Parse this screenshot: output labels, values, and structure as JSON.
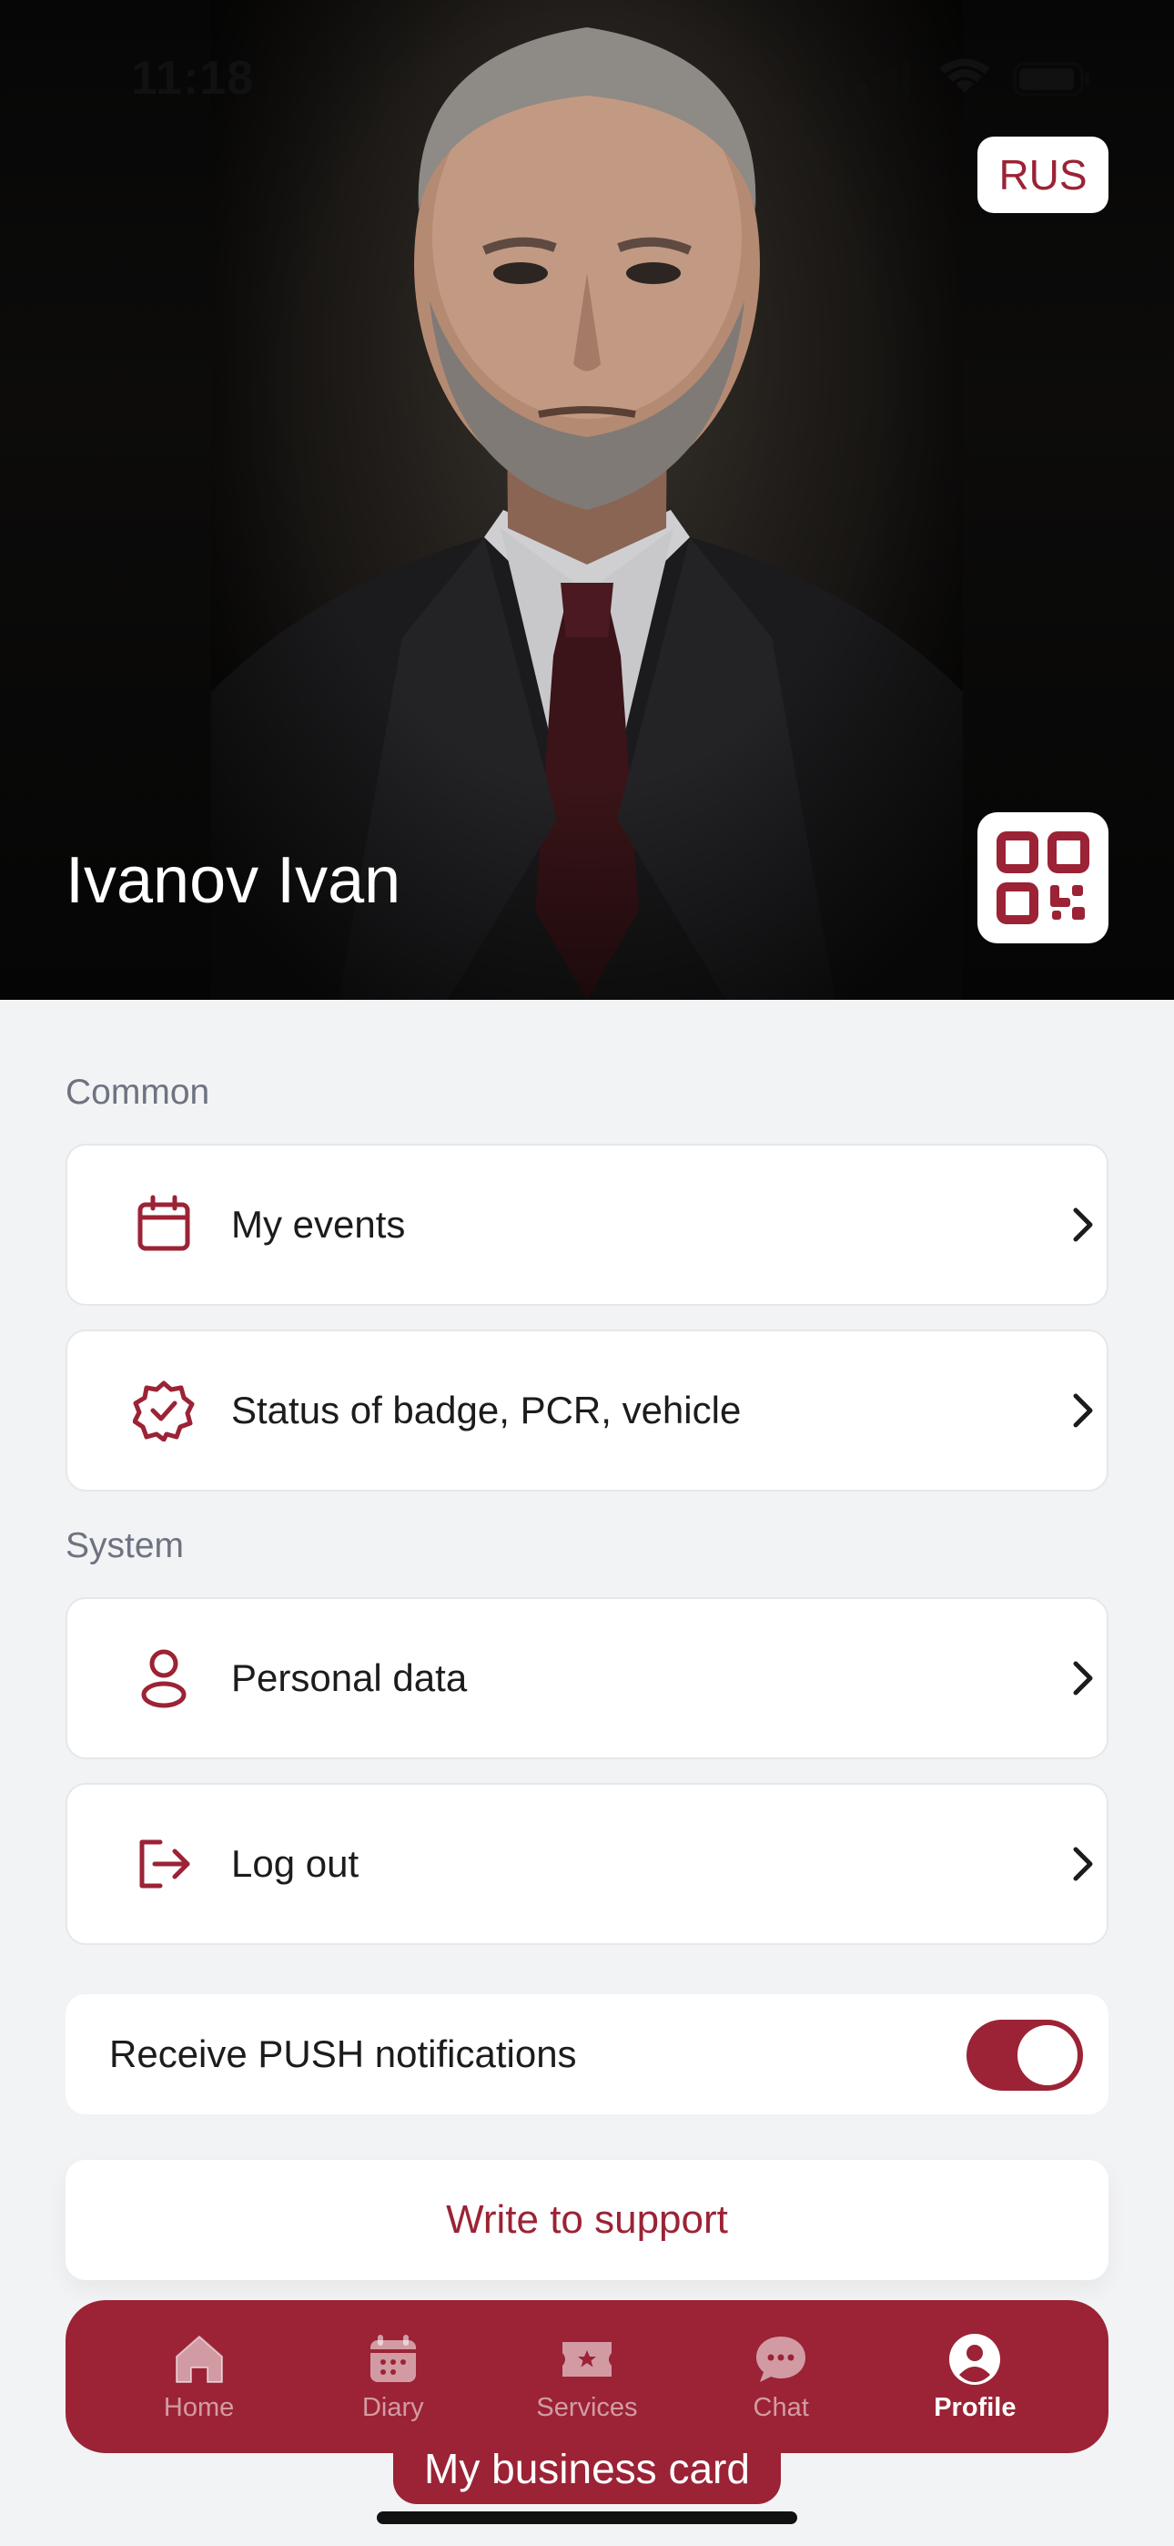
{
  "status_bar": {
    "time": "11:18"
  },
  "hero": {
    "name": "Ivanov Ivan",
    "language_button": "RUS"
  },
  "sections": {
    "common": {
      "label": "Common",
      "items": [
        {
          "label": "My events",
          "icon": "calendar-icon"
        },
        {
          "label": "Status of badge, PCR, vehicle",
          "icon": "badge-check-icon"
        }
      ]
    },
    "system": {
      "label": "System",
      "items": [
        {
          "label": "Personal data",
          "icon": "user-icon"
        },
        {
          "label": "Log out",
          "icon": "logout-icon"
        }
      ]
    }
  },
  "notifications": {
    "label": "Receive PUSH notifications",
    "enabled": true
  },
  "support_button": "Write to support",
  "business_card_button": "My business card",
  "bottom_nav": {
    "items": [
      {
        "label": "Home",
        "icon": "home-icon",
        "active": false
      },
      {
        "label": "Diary",
        "icon": "calendar-icon",
        "active": false
      },
      {
        "label": "Services",
        "icon": "ticket-star-icon",
        "active": false
      },
      {
        "label": "Chat",
        "icon": "chat-bubble-icon",
        "active": false
      },
      {
        "label": "Profile",
        "icon": "profile-icon",
        "active": true
      }
    ]
  },
  "colors": {
    "accent": "#9b2335",
    "background": "#f2f3f5",
    "card": "#ffffff",
    "section_label": "#6e7380"
  }
}
